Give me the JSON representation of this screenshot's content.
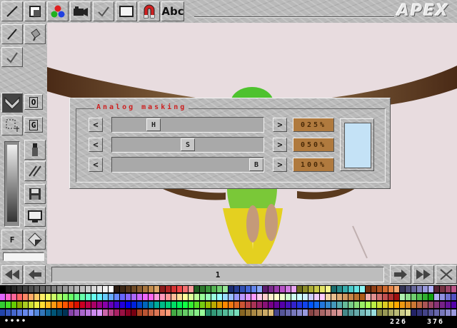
{
  "app": {
    "logo": "APEX"
  },
  "toolbar": {
    "abc_label": "Abc",
    "buttons": [
      "line-tool",
      "box-tool",
      "color-mixer",
      "camera",
      "brush-check",
      "screen",
      "magnet",
      "text-tool"
    ]
  },
  "leftbar": {
    "o_label": "O",
    "g_label": "G",
    "f_label": "F"
  },
  "dialog": {
    "title": "Analog masking",
    "left_arrow": "<",
    "right_arrow": ">",
    "sliders": [
      {
        "knob": "H",
        "value_text": "025%",
        "value": 25
      },
      {
        "knob": "S",
        "value_text": "050%",
        "value": 50
      },
      {
        "knob": "B",
        "value_text": "100%",
        "value": 100
      }
    ],
    "preview_color": "#c4e2f6"
  },
  "bottombar": {
    "frame_number": "1"
  },
  "status": {
    "dots": "••••",
    "x": "226",
    "y": "376"
  },
  "colors": {
    "chrome": "#b9b9b9",
    "value_box": "#b07a3e",
    "title_red": "#cc2020",
    "canvas_bg": "#e8dcdf"
  },
  "palette": {
    "rows": [
      [
        "#000000",
        "#1a1a1a",
        "#262626",
        "#333333",
        "#404040",
        "#4d4d4d",
        "#595959",
        "#666666",
        "#737373",
        "#808080",
        "#8c8c8c",
        "#999999",
        "#a6a6a6",
        "#b3b3b3",
        "#bfbfbf",
        "#cccccc",
        "#d9d9d9",
        "#e6e6e6",
        "#f2f2f2",
        "#ffffff",
        "#2b1b10",
        "#3d2816",
        "#55371d",
        "#6e4a27",
        "#8a5e32",
        "#a8753e",
        "#c48c4c",
        "#dca668",
        "#8c1c1c",
        "#b02626",
        "#d43434",
        "#f04848",
        "#f47070",
        "#f89a9a",
        "#205c20",
        "#2e7a2e",
        "#3c963c",
        "#54b454",
        "#72d072",
        "#98e898",
        "#1c2c70",
        "#263c92",
        "#3250b4",
        "#4466d4",
        "#6284ec",
        "#88a8f8",
        "#5c1c6c",
        "#7a2a8c",
        "#9a3cac",
        "#b854c8",
        "#d07ae0",
        "#e8a4f2",
        "#6c6c1c",
        "#8c8c28",
        "#acac36",
        "#caca4a",
        "#e4e466",
        "#f6f68e",
        "#1c6c6c",
        "#288c8c",
        "#36acac",
        "#4acaca",
        "#66e4e4",
        "#8ef6f6",
        "#703010",
        "#904018",
        "#b05422",
        "#d06a30",
        "#e88648",
        "#f4a870",
        "#333355",
        "#4d4d77",
        "#666699",
        "#8080bb",
        "#9999dd",
        "#b3b3ff",
        "#552233",
        "#773344",
        "#994466",
        "#bb5588"
      ],
      [
        "#e066ff",
        "#ff66cc",
        "#ff6699",
        "#ff6666",
        "#ff8866",
        "#ffaa66",
        "#ffcc66",
        "#ffee66",
        "#eeff66",
        "#ccff66",
        "#aaff66",
        "#88ff66",
        "#66ff66",
        "#66ff88",
        "#66ffaa",
        "#66ffcc",
        "#66ffee",
        "#66eeff",
        "#66ccff",
        "#66aaff",
        "#6688ff",
        "#6666ff",
        "#8866ff",
        "#aa66ff",
        "#cc66ff",
        "#ee66ff",
        "#ff66ee",
        "#ff99dd",
        "#ff99bb",
        "#ff9999",
        "#ffbb99",
        "#ffdd99",
        "#ffff99",
        "#ddff99",
        "#bbff99",
        "#99ff99",
        "#99ffbb",
        "#99ffdd",
        "#99ffff",
        "#99ddff",
        "#99bbff",
        "#9999ff",
        "#bb99ff",
        "#dd99ff",
        "#ff99ff",
        "#ffccee",
        "#ffcccc",
        "#ffeecc",
        "#ffffcc",
        "#eeffcc",
        "#ccffcc",
        "#ccffee",
        "#ccffff",
        "#cceeff",
        "#ccccff",
        "#eeccff",
        "#ffccff",
        "#f4d4a8",
        "#e8c090",
        "#dcac78",
        "#d09860",
        "#c48448",
        "#b87030",
        "#ac5c18",
        "#f0b0b0",
        "#e09090",
        "#d07070",
        "#c05050",
        "#b03030",
        "#a01010",
        "#b0f0b0",
        "#90e090",
        "#70d070",
        "#50c050",
        "#30b030",
        "#10a010",
        "#b0b0f0",
        "#9090e0",
        "#7070d0",
        "#5050c0"
      ],
      [
        "#33cc33",
        "#44dd22",
        "#66cc00",
        "#88aa00",
        "#aacc22",
        "#ccdd33",
        "#eeee44",
        "#ffdd33",
        "#ffbb22",
        "#ff9911",
        "#ff7700",
        "#ff5500",
        "#ee3300",
        "#dd1100",
        "#cc0022",
        "#bb0044",
        "#aa0066",
        "#990088",
        "#8800aa",
        "#6600bb",
        "#4400cc",
        "#2200dd",
        "#0000ee",
        "#0022dd",
        "#0044cc",
        "#0066bb",
        "#0088aa",
        "#00aa99",
        "#00bb88",
        "#00cc77",
        "#00dd66",
        "#00ee55",
        "#11ff44",
        "#33ee33",
        "#55dd22",
        "#77cc11",
        "#99bb00",
        "#bbaa00",
        "#dd9900",
        "#ff8800",
        "#ee7711",
        "#dd6622",
        "#cc5533",
        "#bb4444",
        "#aa3355",
        "#992266",
        "#881177",
        "#770088",
        "#660099",
        "#5500aa",
        "#4411bb",
        "#3322cc",
        "#2233dd",
        "#1144ee",
        "#0055ff",
        "#1166ee",
        "#2277dd",
        "#3388cc",
        "#4499bb",
        "#55aaaa",
        "#66bb99",
        "#77cc88",
        "#88dd77",
        "#99ee66",
        "#aaff55",
        "#bbee44",
        "#ccdd33",
        "#ddcc22",
        "#eebb11",
        "#ffaa00",
        "#ee9911",
        "#dd8822",
        "#cc7733",
        "#bb6644",
        "#aa5555",
        "#994466",
        "#883377",
        "#772288",
        "#661199",
        "#5500aa"
      ],
      [
        "#2244aa",
        "#3355bb",
        "#4466cc",
        "#5577dd",
        "#6688ee",
        "#7799ff",
        "#5588dd",
        "#3377bb",
        "#116699",
        "#005577",
        "#004466",
        "#003355",
        "#8844aa",
        "#9955bb",
        "#aa66cc",
        "#bb77dd",
        "#cc88ee",
        "#dd99ff",
        "#cc66aa",
        "#bb4488",
        "#aa2266",
        "#991144",
        "#880022",
        "#770011",
        "#aa4422",
        "#bb5533",
        "#cc6644",
        "#dd7755",
        "#ee8866",
        "#ff9977",
        "#44aa44",
        "#55bb55",
        "#66cc66",
        "#77dd77",
        "#88ee88",
        "#99ff99",
        "#228866",
        "#339977",
        "#44aa88",
        "#55bb99",
        "#66ccaa",
        "#77ddbb",
        "#886622",
        "#997733",
        "#aa8844",
        "#bb9955",
        "#ccaa66",
        "#ddbb77",
        "#444488",
        "#555599",
        "#6666aa",
        "#7777bb",
        "#8888cc",
        "#9999dd",
        "#884444",
        "#995555",
        "#aa6666",
        "#bb7777",
        "#cc8888",
        "#dd9999",
        "#448888",
        "#559999",
        "#66aaaa",
        "#77bbbb",
        "#88cccc",
        "#99dddd",
        "#888844",
        "#999955",
        "#aaaa66",
        "#bbbb77",
        "#cccc88",
        "#dddd99",
        "#222266",
        "#333377",
        "#444488",
        "#555599",
        "#6666aa",
        "#7777bb",
        "#8888cc",
        "#9999dd"
      ]
    ]
  }
}
